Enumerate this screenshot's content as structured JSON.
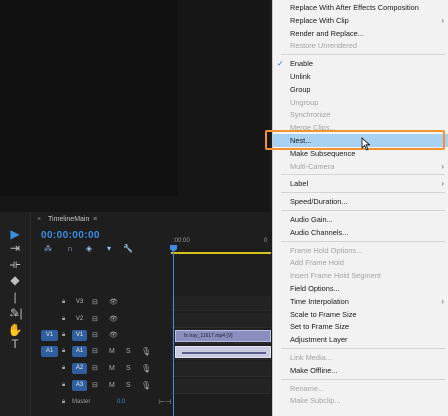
{
  "monitor": {},
  "tools": [
    {
      "name": "selection-tool",
      "glyph": "▶",
      "active": true
    },
    {
      "name": "track-select-tool",
      "glyph": "⇥",
      "active": false
    },
    {
      "name": "ripple-edit-tool",
      "glyph": "⟛",
      "active": false
    },
    {
      "name": "razor-tool",
      "glyph": "◆",
      "active": false
    },
    {
      "name": "slip-tool",
      "glyph": "|↔|",
      "active": false
    },
    {
      "name": "pen-tool",
      "glyph": "✎",
      "active": false
    },
    {
      "name": "hand-tool",
      "glyph": "✋",
      "active": false
    },
    {
      "name": "type-tool",
      "glyph": "T",
      "active": false
    }
  ],
  "timeline": {
    "close_glyph": "×",
    "sequence_name": "TimelineMain",
    "menu_glyph": "≡",
    "timecode": "00:00:00:00",
    "ruler_label": ":00:00",
    "ruler_label2": "0",
    "tracks": [
      {
        "source": "",
        "source_on": false,
        "name": "V3",
        "name_sel": false,
        "icons": [
          "⊟",
          "👁",
          "",
          ""
        ],
        "type": "video",
        "clip": null
      },
      {
        "source": "",
        "source_on": false,
        "name": "V2",
        "name_sel": false,
        "icons": [
          "⊟",
          "👁",
          "",
          ""
        ],
        "type": "video",
        "clip": null
      },
      {
        "source": "V1",
        "source_on": true,
        "name": "V1",
        "name_sel": true,
        "icons": [
          "⊟",
          "👁",
          "",
          ""
        ],
        "type": "video",
        "clip": "fx  Iray_11617.mp4 [V]"
      },
      {
        "source": "A1",
        "source_on": true,
        "name": "A1",
        "name_sel": true,
        "icons": [
          "⊟",
          "M",
          "S",
          "🎙"
        ],
        "type": "audio",
        "clip": "audio"
      },
      {
        "source": "",
        "source_on": false,
        "name": "A2",
        "name_sel": true,
        "icons": [
          "⊟",
          "M",
          "S",
          "🎙"
        ],
        "type": "audio",
        "clip": null
      },
      {
        "source": "",
        "source_on": false,
        "name": "A3",
        "name_sel": true,
        "icons": [
          "⊟",
          "M",
          "S",
          "🎙"
        ],
        "type": "audio",
        "clip": null
      }
    ],
    "master": {
      "label": "Master",
      "value": "0.0",
      "icon": "⊢⊣"
    }
  },
  "menu": {
    "items": [
      {
        "label": "Replace With After Effects Composition",
        "disabled": false
      },
      {
        "label": "Replace With Clip",
        "disabled": false,
        "submenu": true
      },
      {
        "label": "Render and Replace...",
        "disabled": false
      },
      {
        "label": "Restore Unrendered",
        "disabled": true
      },
      {
        "sep": true
      },
      {
        "label": "Enable",
        "disabled": false,
        "checked": true
      },
      {
        "label": "Unlink",
        "disabled": false
      },
      {
        "label": "Group",
        "disabled": false
      },
      {
        "label": "Ungroup",
        "disabled": true
      },
      {
        "label": "Synchronize",
        "disabled": true
      },
      {
        "label": "Merge Clips...",
        "disabled": true
      },
      {
        "label": "Nest...",
        "disabled": false,
        "highlighted": true
      },
      {
        "label": "Make Subsequence",
        "disabled": false
      },
      {
        "label": "Multi-Camera",
        "disabled": true,
        "submenu": true
      },
      {
        "sep": true
      },
      {
        "label": "Label",
        "disabled": false,
        "submenu": true
      },
      {
        "sep": true
      },
      {
        "label": "Speed/Duration...",
        "disabled": false
      },
      {
        "sep": true
      },
      {
        "label": "Audio Gain...",
        "disabled": false
      },
      {
        "label": "Audio Channels...",
        "disabled": false
      },
      {
        "sep": true
      },
      {
        "label": "Frame Hold Options...",
        "disabled": true
      },
      {
        "label": "Add Frame Hold",
        "disabled": true
      },
      {
        "label": "Insert Frame Hold Segment",
        "disabled": true
      },
      {
        "label": "Field Options...",
        "disabled": false
      },
      {
        "label": "Time Interpolation",
        "disabled": false,
        "submenu": true
      },
      {
        "label": "Scale to Frame Size",
        "disabled": false
      },
      {
        "label": "Set to Frame Size",
        "disabled": false
      },
      {
        "label": "Adjustment Layer",
        "disabled": false
      },
      {
        "sep": true
      },
      {
        "label": "Link Media...",
        "disabled": true
      },
      {
        "label": "Make Offline...",
        "disabled": false
      },
      {
        "sep": true
      },
      {
        "label": "Rename...",
        "disabled": true
      },
      {
        "label": "Make Subclip...",
        "disabled": true
      }
    ],
    "check_glyph": "✓",
    "arrow_glyph": "›"
  },
  "colors": {
    "accent": "#3d8ce0",
    "highlight": "#a9d1f2",
    "focus_outline": "#f29430",
    "clip_video": "#8a8fc0",
    "playhead_bar": "#d5c11c"
  }
}
